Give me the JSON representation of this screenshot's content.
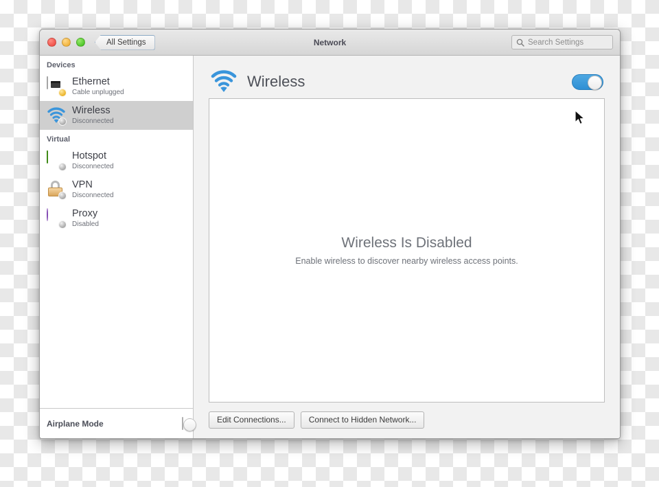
{
  "window": {
    "title": "Network",
    "back_button": "All Settings",
    "traffic_lights": [
      "close-button",
      "minimize-button",
      "maximize-button"
    ]
  },
  "search": {
    "placeholder": "Search Settings",
    "icon": "search-icon",
    "value": ""
  },
  "sidebar": {
    "groups": [
      {
        "label": "Devices",
        "items": [
          {
            "label": "Ethernet",
            "status": "Cable unplugged",
            "icon": "ethernet-icon",
            "badge": "yellow",
            "selected": false
          },
          {
            "label": "Wireless",
            "status": "Disconnected",
            "icon": "wireless-icon",
            "badge": "gray",
            "selected": true
          }
        ]
      },
      {
        "label": "Virtual",
        "items": [
          {
            "label": "Hotspot",
            "status": "Disconnected",
            "icon": "hotspot-icon",
            "badge": "gray",
            "selected": false
          },
          {
            "label": "VPN",
            "status": "Disconnected",
            "icon": "vpn-lock-icon",
            "badge": "gray",
            "selected": false
          },
          {
            "label": "Proxy",
            "status": "Disabled",
            "icon": "proxy-globe-icon",
            "badge": "gray",
            "selected": false
          }
        ]
      }
    ],
    "footer": {
      "label": "Airplane Mode",
      "toggle_state": "off"
    }
  },
  "content": {
    "icon": "wireless-icon",
    "title": "Wireless",
    "toggle_state": "on",
    "empty_state": {
      "title": "Wireless Is Disabled",
      "subtitle": "Enable wireless to discover nearby wireless access points."
    },
    "buttons": [
      {
        "label": "Edit Connections..."
      },
      {
        "label": "Connect to Hidden Network..."
      }
    ]
  },
  "colors": {
    "accent": "#3a90d4",
    "selected_row": "#cfcfcf",
    "window_chrome": "#dcdcdc",
    "badge_warning": "#e8ab18",
    "hotspot_green": "#4fa51f",
    "vpn_orange": "#d9a65c",
    "proxy_purple": "#9a5ec9"
  }
}
